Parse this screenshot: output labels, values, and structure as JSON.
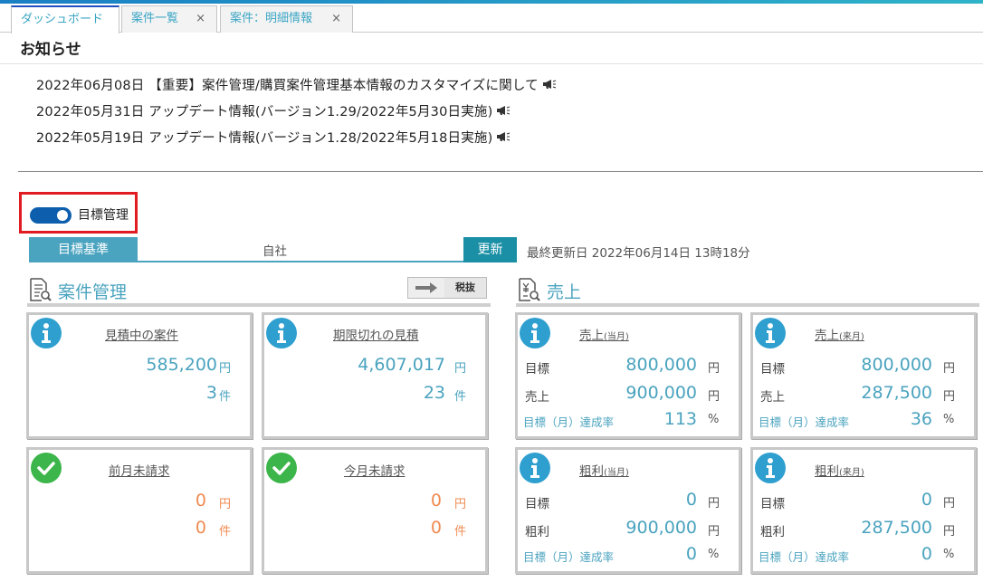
{
  "tabs": [
    {
      "label": "ダッシュボード",
      "closable": false
    },
    {
      "label": "案件一覧",
      "closable": true
    },
    {
      "label": "案件：明細情報",
      "closable": true
    }
  ],
  "close_glyph": "×",
  "notices": {
    "title": "お知らせ",
    "items": [
      "2022年06月08日 【重要】案件管理/購買案件管理基本情報のカスタマイズに関して",
      "2022年05月31日 アップデート情報(バージョン1.29/2022年5月30日実施)",
      "2022年05月19日 アップデート情報(バージョン1.28/2022年5月18日実施)"
    ],
    "icon": "megaphone-icon"
  },
  "goal_toggle": {
    "label": "目標管理",
    "on": true
  },
  "goal_bar": {
    "basis_label": "目標基準",
    "company_label": "自社",
    "refresh_label": "更新",
    "last_updated": "最終更新日 2022年06月14日 13時18分"
  },
  "case_panel": {
    "title": "案件管理",
    "tax_label": "税抜",
    "cards": [
      {
        "title": "見積中の案件",
        "amount": "585,200",
        "amount_unit": "円",
        "count": "3",
        "count_unit": "件",
        "icon": "info-icon"
      },
      {
        "title": "期限切れの見積",
        "amount": "4,607,017",
        "amount_unit": "円",
        "count": "23",
        "count_unit": "件",
        "icon": "info-icon"
      },
      {
        "title": "前月未請求",
        "amount": "0",
        "amount_unit": "円",
        "count": "0",
        "count_unit": "件",
        "icon": "check-icon"
      },
      {
        "title": "今月未請求",
        "amount": "0",
        "amount_unit": "円",
        "count": "0",
        "count_unit": "件",
        "icon": "check-icon"
      }
    ]
  },
  "sales_panel": {
    "title": "売上",
    "cards": [
      {
        "title": "売上",
        "period": "(当月)",
        "target_label": "目標",
        "target": "800,000",
        "actual_label": "売上",
        "actual": "900,000",
        "yen": "円",
        "rate_label": "目標（月）達成率",
        "rate": "113",
        "pct": "%"
      },
      {
        "title": "売上",
        "period": "(来月)",
        "target_label": "目標",
        "target": "800,000",
        "actual_label": "売上",
        "actual": "287,500",
        "yen": "円",
        "rate_label": "目標（月）達成率",
        "rate": "36",
        "pct": "%"
      },
      {
        "title": "粗利",
        "period": "(当月)",
        "target_label": "目標",
        "target": "0",
        "actual_label": "粗利",
        "actual": "900,000",
        "yen": "円",
        "rate_label": "目標（月）達成率",
        "rate": "0",
        "pct": "%"
      },
      {
        "title": "粗利",
        "period": "(来月)",
        "target_label": "目標",
        "target": "0",
        "actual_label": "粗利",
        "actual": "287,500",
        "yen": "円",
        "rate_label": "目標（月）達成率",
        "rate": "0",
        "pct": "%"
      }
    ]
  },
  "colors": {
    "accent": "#4aa3bf",
    "orange": "#ef8b52",
    "toggle": "#0d5fae",
    "highlight": "#e11b22",
    "check": "#3cb54a"
  }
}
